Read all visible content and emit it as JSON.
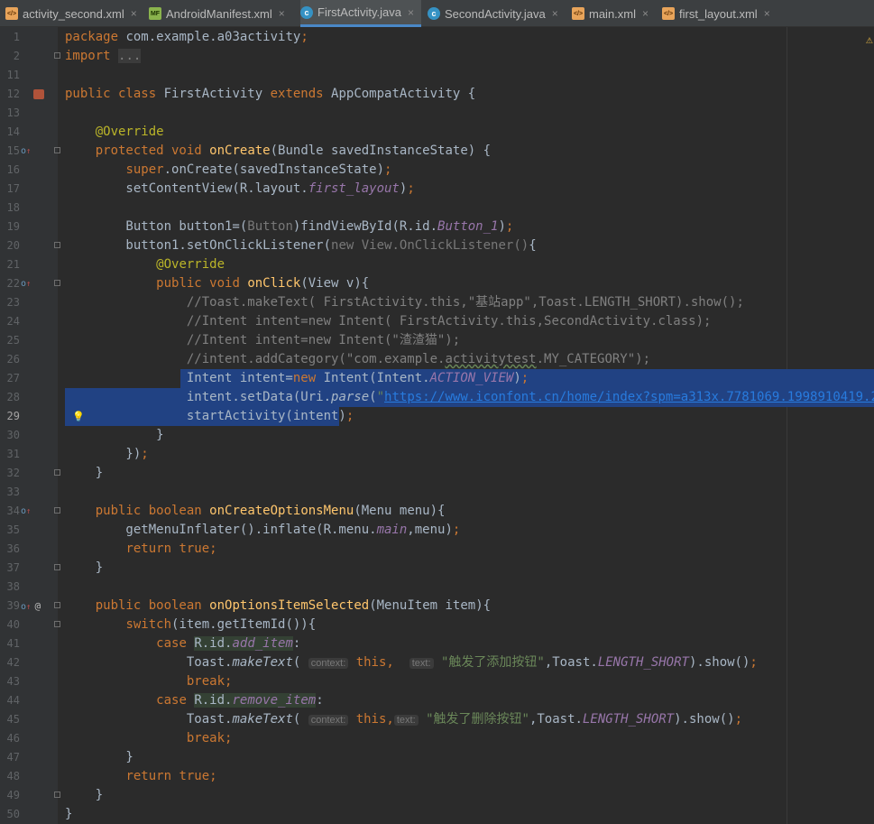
{
  "tabs": [
    {
      "label": "activity_second.xml",
      "type": "xml",
      "active": false
    },
    {
      "label": "AndroidManifest.xml",
      "type": "manifest",
      "active": false
    },
    {
      "label": "FirstActivity.java",
      "type": "java",
      "active": true
    },
    {
      "label": "SecondActivity.java",
      "type": "java",
      "active": false
    },
    {
      "label": "main.xml",
      "type": "xml",
      "active": false
    },
    {
      "label": "first_layout.xml",
      "type": "xml",
      "active": false
    }
  ],
  "tab_icon_text": {
    "xml": "</>",
    "manifest": "MF",
    "java": "c"
  },
  "tab_close_glyph": "×",
  "editor": {
    "warning_icon": "warning-triangle-icon",
    "lines": [
      {
        "n": "1",
        "t": [
          [
            "package",
            "kw"
          ],
          [
            " com.example.a03activity",
            ""
          ],
          [
            ";",
            "kw"
          ]
        ]
      },
      {
        "n": "2",
        "t": [
          [
            "import",
            "kw"
          ],
          [
            " ",
            ""
          ],
          [
            "...",
            "fade"
          ]
        ]
      },
      {
        "n": "11",
        "t": []
      },
      {
        "n": "12",
        "t": [
          [
            "public class",
            "kw"
          ],
          [
            " FirstActivity ",
            ""
          ],
          [
            "extends",
            "kw"
          ],
          [
            " AppCompatActivity {",
            ""
          ]
        ]
      },
      {
        "n": "13",
        "t": []
      },
      {
        "n": "14",
        "t": [
          [
            "    ",
            ""
          ],
          [
            "@Override",
            "ann"
          ]
        ]
      },
      {
        "n": "15",
        "t": [
          [
            "    ",
            ""
          ],
          [
            "protected void",
            "kw"
          ],
          [
            " ",
            ""
          ],
          [
            "onCreate",
            "fn"
          ],
          [
            "(Bundle savedInstanceState) {",
            ""
          ]
        ]
      },
      {
        "n": "16",
        "t": [
          [
            "        ",
            ""
          ],
          [
            "super",
            "kw"
          ],
          [
            ".onCreate(savedInstanceState)",
            ""
          ],
          [
            ";",
            "kw"
          ]
        ]
      },
      {
        "n": "17",
        "t": [
          [
            "        setContentView(R.layout.",
            ""
          ],
          [
            "first_layout",
            "fld"
          ],
          [
            ")",
            ""
          ],
          [
            ";",
            "kw"
          ]
        ]
      },
      {
        "n": "18",
        "t": []
      },
      {
        "n": "19",
        "t": [
          [
            "        Button button1=(",
            ""
          ],
          [
            "Button",
            "par"
          ],
          [
            ")findViewById(R.id.",
            ""
          ],
          [
            "Button_1",
            "fld"
          ],
          [
            ")",
            ""
          ],
          [
            ";",
            "kw"
          ]
        ]
      },
      {
        "n": "20",
        "t": [
          [
            "        button1.setOnClickListener(",
            ""
          ],
          [
            "new",
            "par"
          ],
          [
            " ",
            ""
          ],
          [
            "View.OnClickListener()",
            "par"
          ],
          [
            "{",
            ""
          ]
        ]
      },
      {
        "n": "21",
        "t": [
          [
            "            ",
            ""
          ],
          [
            "@Override",
            "ann"
          ]
        ]
      },
      {
        "n": "22",
        "t": [
          [
            "            ",
            ""
          ],
          [
            "public void",
            "kw"
          ],
          [
            " ",
            ""
          ],
          [
            "onClick",
            "fn"
          ],
          [
            "(View v){",
            ""
          ]
        ]
      },
      {
        "n": "23",
        "t": [
          [
            "                ",
            ""
          ],
          [
            "//Toast.makeText( FirstActivity.this,\"基站app\",Toast.LENGTH_SHORT).show();",
            "com"
          ]
        ]
      },
      {
        "n": "24",
        "t": [
          [
            "                ",
            ""
          ],
          [
            "//Intent intent=new Intent( FirstActivity.this,SecondActivity.class);",
            "com"
          ]
        ]
      },
      {
        "n": "25",
        "t": [
          [
            "                ",
            ""
          ],
          [
            "//Intent intent=new Intent(\"渣渣猫\");",
            "com"
          ]
        ]
      },
      {
        "n": "26",
        "t": [
          [
            "                ",
            ""
          ],
          [
            "//intent.addCategory(\"com.example.",
            "com"
          ],
          [
            "activitytest",
            "com typo"
          ],
          [
            ".MY_CATEGORY\");",
            "com"
          ]
        ]
      },
      {
        "n": "27",
        "t": [
          [
            "                Intent intent=",
            ""
          ],
          [
            "new",
            "kw"
          ],
          [
            " Intent(Intent.",
            ""
          ],
          [
            "ACTION_VIEW",
            "fld"
          ],
          [
            ")",
            ""
          ],
          [
            ";",
            "kw"
          ]
        ]
      },
      {
        "n": "28",
        "t": [
          [
            "                intent.setData(Uri.",
            ""
          ],
          [
            "parse",
            "mth"
          ],
          [
            "(",
            ""
          ],
          [
            "\"",
            "str"
          ],
          [
            "https://www.iconfont.cn/home/index?spm=a313x.7781069.1998910419.2",
            "link"
          ],
          [
            "\"",
            "str"
          ],
          [
            "))",
            ""
          ],
          [
            ";",
            "kw"
          ]
        ]
      },
      {
        "n": "29",
        "t": [
          [
            "                startActivity(intent)",
            ""
          ],
          [
            ";",
            "kw"
          ]
        ]
      },
      {
        "n": "30",
        "t": [
          [
            "            }",
            ""
          ]
        ]
      },
      {
        "n": "31",
        "t": [
          [
            "        })",
            ""
          ],
          [
            ";",
            "kw"
          ]
        ]
      },
      {
        "n": "32",
        "t": [
          [
            "    }",
            ""
          ]
        ]
      },
      {
        "n": "33",
        "t": []
      },
      {
        "n": "34",
        "t": [
          [
            "    ",
            ""
          ],
          [
            "public boolean",
            "kw"
          ],
          [
            " ",
            ""
          ],
          [
            "onCreateOptionsMenu",
            "fn"
          ],
          [
            "(Menu menu){",
            ""
          ]
        ]
      },
      {
        "n": "35",
        "t": [
          [
            "        getMenuInflater().inflate(R.menu.",
            ""
          ],
          [
            "main",
            "fld"
          ],
          [
            ",menu)",
            ""
          ],
          [
            ";",
            "kw"
          ]
        ]
      },
      {
        "n": "36",
        "t": [
          [
            "        ",
            ""
          ],
          [
            "return true",
            "kw"
          ],
          [
            ";",
            "kw"
          ]
        ]
      },
      {
        "n": "37",
        "t": [
          [
            "    }",
            ""
          ]
        ]
      },
      {
        "n": "38",
        "t": []
      },
      {
        "n": "39",
        "t": [
          [
            "    ",
            ""
          ],
          [
            "public boolean",
            "kw"
          ],
          [
            " ",
            ""
          ],
          [
            "onOptionsItemSelected",
            "fn"
          ],
          [
            "(MenuItem item){",
            ""
          ]
        ]
      },
      {
        "n": "40",
        "t": [
          [
            "        ",
            ""
          ],
          [
            "switch",
            "kw"
          ],
          [
            "(item.getItemId()){",
            ""
          ]
        ]
      },
      {
        "n": "41",
        "t": [
          [
            "            ",
            ""
          ],
          [
            "case",
            "kw"
          ],
          [
            " ",
            ""
          ],
          [
            "R.id.",
            "rhl"
          ],
          [
            "add_item",
            "fld rhl"
          ],
          [
            ":",
            ""
          ]
        ]
      },
      {
        "n": "42",
        "t": [
          [
            "                Toast.",
            ""
          ],
          [
            "makeText",
            "mth"
          ],
          [
            "( ",
            ""
          ],
          [
            "context:",
            "hint"
          ],
          [
            " ",
            ""
          ],
          [
            "this,",
            "kw"
          ],
          [
            "  ",
            ""
          ],
          [
            "text:",
            "hint"
          ],
          [
            " ",
            ""
          ],
          [
            "\"触发了添加按钮\"",
            "str"
          ],
          [
            ",Toast.",
            ""
          ],
          [
            "LENGTH_SHORT",
            "fld"
          ],
          [
            ").show()",
            ""
          ],
          [
            ";",
            "kw"
          ]
        ]
      },
      {
        "n": "43",
        "t": [
          [
            "                ",
            ""
          ],
          [
            "break;",
            "kw"
          ]
        ]
      },
      {
        "n": "44",
        "t": [
          [
            "            ",
            ""
          ],
          [
            "case",
            "kw"
          ],
          [
            " ",
            ""
          ],
          [
            "R.id.",
            "rhl"
          ],
          [
            "remove_item",
            "fld rhl"
          ],
          [
            ":",
            ""
          ]
        ]
      },
      {
        "n": "45",
        "t": [
          [
            "                Toast.",
            ""
          ],
          [
            "makeText",
            "mth"
          ],
          [
            "( ",
            ""
          ],
          [
            "context:",
            "hint"
          ],
          [
            " ",
            ""
          ],
          [
            "this,",
            "kw"
          ],
          [
            "text:",
            "hint"
          ],
          [
            " ",
            ""
          ],
          [
            "\"触发了删除按钮\"",
            "str"
          ],
          [
            ",Toast.",
            ""
          ],
          [
            "LENGTH_SHORT",
            "fld"
          ],
          [
            ").show()",
            ""
          ],
          [
            ";",
            "kw"
          ]
        ]
      },
      {
        "n": "46",
        "t": [
          [
            "                ",
            ""
          ],
          [
            "break;",
            "kw"
          ]
        ]
      },
      {
        "n": "47",
        "t": [
          [
            "        }",
            ""
          ]
        ]
      },
      {
        "n": "48",
        "t": [
          [
            "        ",
            ""
          ],
          [
            "return true",
            "kw"
          ],
          [
            ";",
            "kw"
          ]
        ]
      },
      {
        "n": "49",
        "t": [
          [
            "    }",
            ""
          ]
        ]
      },
      {
        "n": "50",
        "t": [
          [
            "}",
            ""
          ]
        ]
      }
    ],
    "gutter_marks": {
      "12": "class-icon",
      "15": "override-up-icon",
      "22": "override-up-icon",
      "34": "override-up-icon",
      "39": "override-up-at-icon"
    },
    "folds": [
      "2",
      "15",
      "20",
      "22",
      "32",
      "34",
      "37",
      "39",
      "40",
      "49"
    ],
    "current_line": "29",
    "intention_bulb_line": "29",
    "selection_lines": [
      "27",
      "28",
      "29"
    ]
  }
}
